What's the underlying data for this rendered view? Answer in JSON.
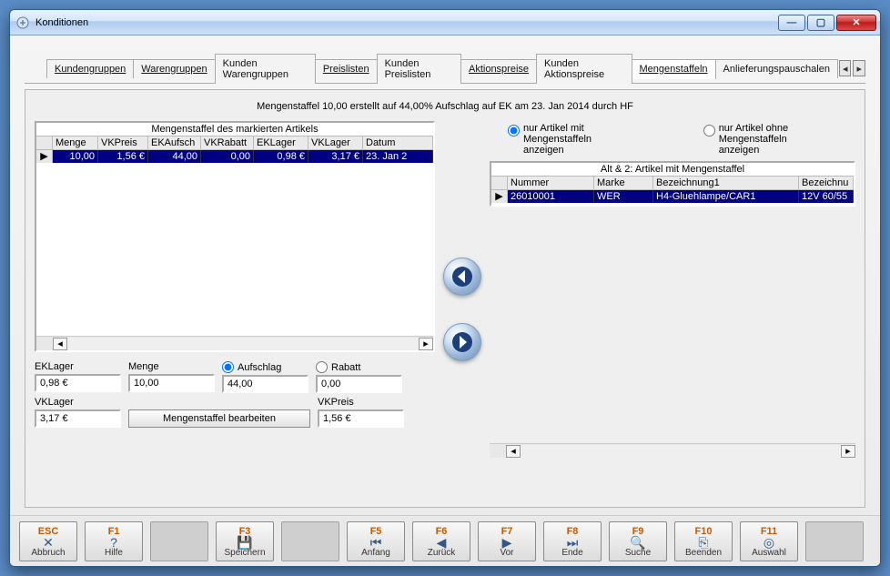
{
  "window": {
    "title": "Konditionen"
  },
  "tabs": {
    "items": [
      {
        "label": "Kundengruppen",
        "underline": true
      },
      {
        "label": "Warengruppen",
        "underline": true
      },
      {
        "label": "Kunden Warengruppen",
        "underline": false
      },
      {
        "label": "Preislisten",
        "underline": true
      },
      {
        "label": "Kunden Preislisten",
        "underline": false
      },
      {
        "label": "Aktionspreise",
        "underline": true
      },
      {
        "label": "Kunden Aktionspreise",
        "underline": false
      },
      {
        "label": "Mengenstaffeln",
        "underline": true,
        "active": true
      },
      {
        "label": "Anlieferungspauschalen",
        "underline": false
      }
    ]
  },
  "info_line": "Mengenstaffel 10,00 erstellt auf 44,00% Aufschlag auf EK am 23. Jan 2014 durch HF",
  "left_grid": {
    "title": "Mengenstaffel des markierten Artikels",
    "headers": [
      "Menge",
      "VKPreis",
      "EKAufsch",
      "VKRabatt",
      "EKLager",
      "VKLager",
      "Datum"
    ],
    "row": {
      "menge": "10,00",
      "vkpreis": "1,56 €",
      "ekauf": "44,00",
      "vkrab": "0,00",
      "eklager": "0,98 €",
      "vklager": "3,17 €",
      "datum": "23. Jan 2"
    }
  },
  "right_filter": {
    "opt1": "nur Artikel mit\nMengenstaffeln anzeigen",
    "opt2": "nur Artikel ohne Mengenstaffeln\nanzeigen"
  },
  "right_grid": {
    "title": "Alt & 2: Artikel mit Mengenstaffel",
    "headers": [
      "Nummer",
      "Marke",
      "Bezeichnung1",
      "Bezeichnu"
    ],
    "row": {
      "nummer": "26010001",
      "marke": "WER",
      "bez1": "H4-Gluehlampe/CAR1",
      "bez2": "12V 60/55"
    }
  },
  "form": {
    "eklager_label": "EKLager",
    "eklager": "0,98 €",
    "menge_label": "Menge",
    "menge": "10,00",
    "aufschlag_label": "Aufschlag",
    "aufschlag": "44,00",
    "rabatt_label": "Rabatt",
    "rabatt": "0,00",
    "vklager_label": "VKLager",
    "vklager": "3,17 €",
    "vkpreis_label": "VKPreis",
    "vkpreis": "1,56 €",
    "edit_button": "Mengenstaffel bearbeiten"
  },
  "fkeys": [
    {
      "key": "ESC",
      "icon": "✕",
      "label": "Abbruch",
      "blank": false,
      "name": "fkey-esc"
    },
    {
      "key": "F1",
      "icon": "?",
      "label": "Hilfe",
      "blank": false,
      "name": "fkey-f1"
    },
    {
      "blank": true,
      "name": "fkey-f2"
    },
    {
      "key": "F3",
      "icon": "💾",
      "label": "Speichern",
      "blank": false,
      "name": "fkey-f3"
    },
    {
      "blank": true,
      "name": "fkey-f4"
    },
    {
      "key": "F5",
      "icon": "⏮",
      "label": "Anfang",
      "blank": false,
      "name": "fkey-f5"
    },
    {
      "key": "F6",
      "icon": "◀",
      "label": "Zurück",
      "blank": false,
      "name": "fkey-f6"
    },
    {
      "key": "F7",
      "icon": "▶",
      "label": "Vor",
      "blank": false,
      "name": "fkey-f7"
    },
    {
      "key": "F8",
      "icon": "⏭",
      "label": "Ende",
      "blank": false,
      "name": "fkey-f8"
    },
    {
      "key": "F9",
      "icon": "🔍",
      "label": "Suche",
      "blank": false,
      "name": "fkey-f9"
    },
    {
      "key": "F10",
      "icon": "⎘",
      "label": "Beenden",
      "blank": false,
      "name": "fkey-f10"
    },
    {
      "key": "F11",
      "icon": "◎",
      "label": "Auswahl",
      "blank": false,
      "name": "fkey-f11"
    },
    {
      "blank": true,
      "name": "fkey-f12"
    }
  ]
}
